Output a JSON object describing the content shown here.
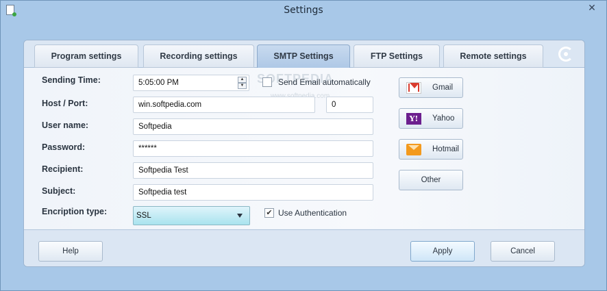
{
  "window": {
    "title": "Settings",
    "close_glyph": "✕"
  },
  "tabs": [
    {
      "label": "Program settings"
    },
    {
      "label": "Recording settings"
    },
    {
      "label": "SMTP Settings"
    },
    {
      "label": "FTP Settings"
    },
    {
      "label": "Remote settings"
    }
  ],
  "form": {
    "sending_time": {
      "label": "Sending Time:",
      "value": "5:05:00 PM"
    },
    "send_auto": {
      "label": "Send Email automatically",
      "checked": false
    },
    "host_port": {
      "label": "Host / Port:",
      "host": "win.softpedia.com",
      "port": "0"
    },
    "username": {
      "label": "User name:",
      "value": "Softpedia"
    },
    "password": {
      "label": "Password:",
      "value": "******"
    },
    "recipient": {
      "label": "Recipient:",
      "value": "Softpedia Test"
    },
    "subject": {
      "label": "Subject:",
      "value": "Softpedia test"
    },
    "encryption": {
      "label": "Encription type:",
      "value": "SSL"
    },
    "use_auth": {
      "label": "Use Authentication",
      "checked": true,
      "glyph": "✔"
    }
  },
  "services": [
    {
      "label": "Gmail",
      "icon": "gmail-icon"
    },
    {
      "label": "Yahoo",
      "icon": "yahoo-icon",
      "glyph": "Y!"
    },
    {
      "label": "Hotmail",
      "icon": "hotmail-icon"
    },
    {
      "label": "Other",
      "icon": ""
    }
  ],
  "footer": {
    "help": "Help",
    "apply": "Apply",
    "cancel": "Cancel"
  },
  "watermark": {
    "text": "SOFTPEDIA",
    "url": "www.softpedia.com"
  },
  "colors": {
    "active_tab": "#aec8e6",
    "select_bg": "#a9e3ee",
    "window_bg": "#a8c8e8"
  }
}
